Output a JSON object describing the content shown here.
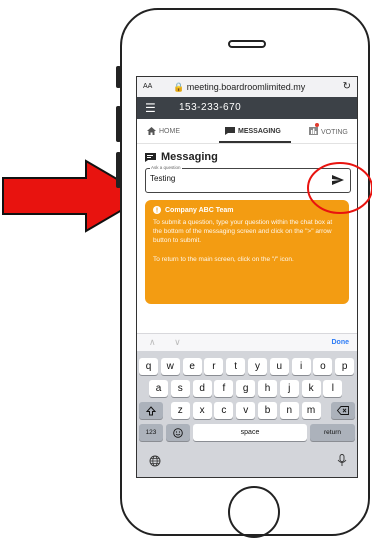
{
  "browser": {
    "text_size": "AA",
    "url": "meeting.boardroomlimited.my",
    "reload": "↻"
  },
  "header": {
    "menu_icon": "☰",
    "title": "153-233-670"
  },
  "tabs": [
    {
      "label": "HOME"
    },
    {
      "label": "MESSAGING"
    },
    {
      "label": "VOTING"
    }
  ],
  "page_title": "Messaging",
  "question_field": {
    "floating_label": "Ask a question",
    "value": "Testing"
  },
  "notice": {
    "title": "Company ABC Team",
    "line1": "To submit a question, type your question within the chat box at the bottom of the messaging screen and click on the \">\" arrow button to submit.",
    "line2": "To return to the main screen, click on the \"/\" icon."
  },
  "keyboard_accessory": {
    "arrows": "∧ ∨",
    "done": "Done"
  },
  "keyboard": {
    "row1": [
      "q",
      "w",
      "e",
      "r",
      "t",
      "y",
      "u",
      "i",
      "o",
      "p"
    ],
    "row2": [
      "a",
      "s",
      "d",
      "f",
      "g",
      "h",
      "j",
      "k",
      "l"
    ],
    "row3": [
      "z",
      "x",
      "c",
      "v",
      "b",
      "n",
      "m"
    ],
    "numbers_key": "123",
    "space_key": "space",
    "return_key": "return"
  },
  "colors": {
    "annotation_arrow": "#e8130f",
    "notice_bg": "#f39c12",
    "appbar_bg": "#3c4147"
  }
}
